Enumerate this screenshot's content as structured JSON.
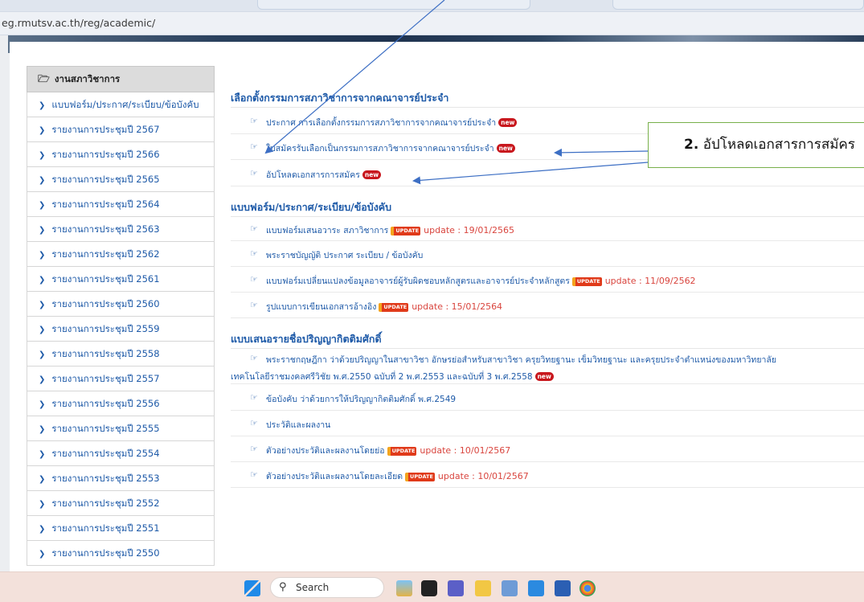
{
  "browser": {
    "url": "eg.rmutsv.ac.th/reg/academic/"
  },
  "sidebar": {
    "header": "งานสภาวิชาการ",
    "items": [
      {
        "label": "แบบฟอร์ม/ประกาศ/ระเบียบ/ข้อบังคับ"
      },
      {
        "label": "รายงานการประชุมปี 2567"
      },
      {
        "label": "รายงานการประชุมปี 2566"
      },
      {
        "label": "รายงานการประชุมปี 2565"
      },
      {
        "label": "รายงานการประชุมปี 2564"
      },
      {
        "label": "รายงานการประชุมปี 2563"
      },
      {
        "label": "รายงานการประชุมปี 2562"
      },
      {
        "label": "รายงานการประชุมปี 2561"
      },
      {
        "label": "รายงานการประชุมปี 2560"
      },
      {
        "label": "รายงานการประชุมปี 2559"
      },
      {
        "label": "รายงานการประชุมปี 2558"
      },
      {
        "label": "รายงานการประชุมปี 2557"
      },
      {
        "label": "รายงานการประชุมปี 2556"
      },
      {
        "label": "รายงานการประชุมปี 2555"
      },
      {
        "label": "รายงานการประชุมปี 2554"
      },
      {
        "label": "รายงานการประชุมปี 2553"
      },
      {
        "label": "รายงานการประชุมปี 2552"
      },
      {
        "label": "รายงานการประชุมปี 2551"
      },
      {
        "label": "รายงานการประชุมปี 2550"
      }
    ]
  },
  "sections": [
    {
      "title": "เลือกตั้งกรรมการสภาวิชาการจากคณาจารย์ประจำ",
      "items": [
        {
          "text": "ประกาศ การเลือกตั้งกรรมการสภาวิชาการจากคณาจารย์ประจำ",
          "badge": "new"
        },
        {
          "text": "ใบสมัครรับเลือกเป็นกรรมการสภาวิชาการจากคณาจารย์ประจำ",
          "badge": "new"
        },
        {
          "text": "อัปโหลดเอกสารการสมัคร",
          "badge": "new"
        }
      ]
    },
    {
      "title": "แบบฟอร์ม/ประกาศ/ระเบียบ/ข้อบังคับ",
      "items": [
        {
          "text": "แบบฟอร์มเสนอวาระ สภาวิชาการ",
          "badge": "UPDATE",
          "update": "update : 19/01/2565"
        },
        {
          "text": "พระราชบัญญัติ ประกาศ ระเบียบ / ข้อบังคับ"
        },
        {
          "text": "แบบฟอร์มเปลี่ยนแปลงข้อมูลอาจารย์ผู้รับผิดชอบหลักสูตรและอาจารย์ประจำหลักสูตร",
          "badge": "UPDATE",
          "update": "update : 11/09/2562"
        },
        {
          "text": "รูปแบบการเขียนเอกสารอ้างอิง",
          "badge": "UPDATE",
          "update": "update : 15/01/2564"
        }
      ]
    },
    {
      "title": "แบบเสนอรายชื่อปริญญากิตติมศักดิ์",
      "items": [
        {
          "text": "พระราชกฤษฎีกา ว่าด้วยปริญญาในสาขาวิชา อักษรย่อสำหรับสาขาวิชา ครุยวิทยฐานะ เข็มวิทยฐานะ และครุยประจำตำแหน่งของมหาวิทยาลัย",
          "text2": "เทคโนโลยีราชมงคลศรีวิชัย พ.ศ.2550 ฉบับที่ 2 พ.ศ.2553 และฉบับที่ 3 พ.ศ.2558",
          "badge": "new"
        },
        {
          "text": "ข้อบังคับ ว่าด้วยการให้ปริญญากิตติมศักดิ์ พ.ศ.2549"
        },
        {
          "text": "ประวัติและผลงาน"
        },
        {
          "text": "ตัวอย่างประวัติและผลงานโดยย่อ",
          "badge": "UPDATE",
          "update": "update : 10/01/2567"
        },
        {
          "text": "ตัวอย่างประวัติและผลงานโดยละเอียด",
          "badge": "UPDATE",
          "update": "update : 10/01/2567"
        }
      ]
    }
  ],
  "callout": {
    "number": "2.",
    "text": "อัปโหลดเอกสารการสมัคร"
  },
  "taskbar": {
    "search_placeholder": "Search"
  },
  "icons": {
    "sidebar_header": "folder-open-icon",
    "bullet": "hand-pointing-icon",
    "sidebar_item": "chevron-right-icon"
  },
  "colors": {
    "link": "#1e5aa8",
    "update_text": "#d9453e",
    "new_badge": "#c8171d",
    "callout_border": "#78b04b",
    "arrow": "#3d6fc4"
  }
}
